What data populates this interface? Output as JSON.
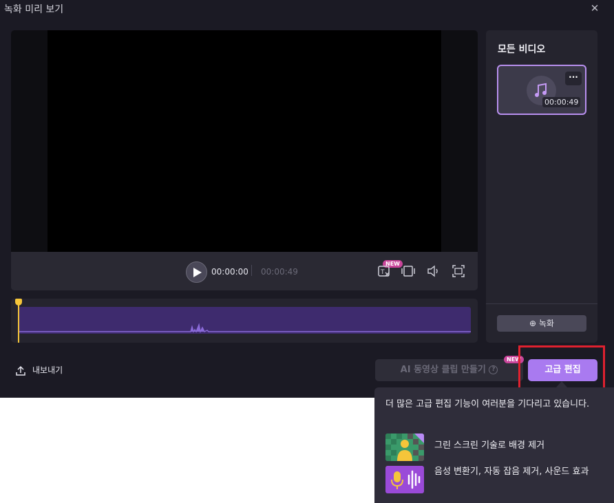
{
  "window": {
    "title": "녹화 미리 보기",
    "close_icon": "close-icon"
  },
  "player": {
    "time_current": "00:00:00",
    "time_total": "00:00:49",
    "new_badge": "NEW",
    "controls": [
      "captions-icon",
      "crop-icon",
      "volume-icon",
      "fullscreen-icon"
    ]
  },
  "sidebar": {
    "title": "모든 비디오",
    "clip": {
      "duration": "00:00:49",
      "more_label": "···",
      "icon": "music-note-icon"
    },
    "record_label": "녹화"
  },
  "footer": {
    "export_label": "내보내기",
    "ai_clip_label": "AI 동영상 클립 만들기",
    "ai_new_badge": "NEW",
    "advanced_edit_label": "고급 편집"
  },
  "tooltip": {
    "heading": "더 많은 고급 편집 기능이 여러분을 기다리고 있습니다.",
    "features": [
      {
        "label": "그린 스크린 기술로 배경 제거",
        "icon": "green-screen-icon"
      },
      {
        "label": "음성 변환기, 자동 잡음 제거, 사운드 효과",
        "icon": "voice-changer-icon"
      }
    ]
  },
  "colors": {
    "accent": "#a97af0",
    "highlight": "#e0212f",
    "playhead": "#f5c53a",
    "badge": "#c9449a"
  }
}
